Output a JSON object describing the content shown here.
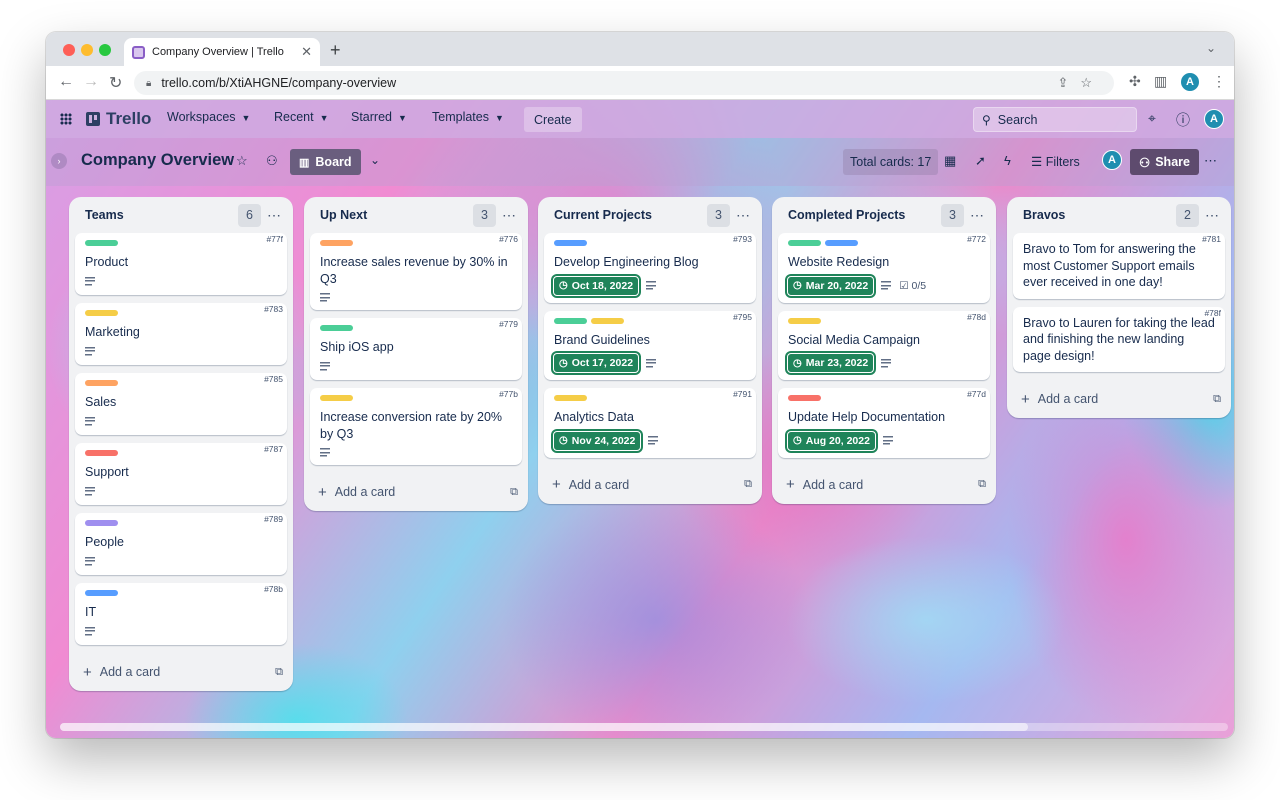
{
  "browser": {
    "tab_title": "Company Overview | Trello",
    "tab_close": "✕",
    "new_tab": "+",
    "url": "trello.com/b/XtiAHGNE/company-overview",
    "profile_initial": "A"
  },
  "topnav": {
    "logo": "Trello",
    "menus": [
      "Workspaces",
      "Recent",
      "Starred",
      "Templates"
    ],
    "create_label": "Create",
    "search_placeholder": "Search",
    "avatar_initial": "A"
  },
  "board": {
    "title": "Company Overview",
    "view_label": "Board",
    "total_cards": "Total cards: 17",
    "filters_label": "Filters",
    "share_label": "Share",
    "member_initial": "A"
  },
  "colors": {
    "green": "#4bce97",
    "yellow": "#f5cd47",
    "orange": "#fea362",
    "red": "#f87168",
    "purple": "#9f8fef",
    "blue": "#579dff",
    "due_green": "#1f845a"
  },
  "lists": [
    {
      "name": "Teams",
      "count": "6",
      "add_label": "Add a card",
      "cards": [
        {
          "id": "#77f",
          "title": "Product",
          "labels": [
            "green"
          ],
          "desc": true
        },
        {
          "id": "#783",
          "title": "Marketing",
          "labels": [
            "yellow"
          ],
          "desc": true
        },
        {
          "id": "#785",
          "title": "Sales",
          "labels": [
            "orange"
          ],
          "desc": true
        },
        {
          "id": "#787",
          "title": "Support",
          "labels": [
            "red"
          ],
          "desc": true
        },
        {
          "id": "#789",
          "title": "People",
          "labels": [
            "purple"
          ],
          "desc": true
        },
        {
          "id": "#78b",
          "title": "IT",
          "labels": [
            "blue"
          ],
          "desc": true
        }
      ]
    },
    {
      "name": "Up Next",
      "count": "3",
      "add_label": "Add a card",
      "cards": [
        {
          "id": "#776",
          "title": "Increase sales revenue by 30% in Q3",
          "labels": [
            "orange"
          ],
          "desc": true
        },
        {
          "id": "#779",
          "title": "Ship iOS app",
          "labels": [
            "green"
          ],
          "desc": true
        },
        {
          "id": "#77b",
          "title": "Increase conversion rate by 20% by Q3",
          "labels": [
            "yellow"
          ],
          "desc": true
        }
      ]
    },
    {
      "name": "Current Projects",
      "count": "3",
      "add_label": "Add a card",
      "cards": [
        {
          "id": "#793",
          "title": "Develop Engineering Blog",
          "labels": [
            "blue"
          ],
          "due": "Oct 18, 2022",
          "desc": true
        },
        {
          "id": "#795",
          "title": "Brand Guidelines",
          "labels": [
            "green",
            "yellow"
          ],
          "due": "Oct 17, 2022",
          "desc": true
        },
        {
          "id": "#791",
          "title": "Analytics Data",
          "labels": [
            "yellow"
          ],
          "due": "Nov 24, 2022",
          "desc": true
        }
      ]
    },
    {
      "name": "Completed Projects",
      "count": "3",
      "add_label": "Add a card",
      "cards": [
        {
          "id": "#772",
          "title": "Website Redesign",
          "labels": [
            "green",
            "blue"
          ],
          "due": "Mar 20, 2022",
          "desc": true,
          "checklist": "0/5"
        },
        {
          "id": "#78d",
          "title": "Social Media Campaign",
          "labels": [
            "yellow"
          ],
          "due": "Mar 23, 2022",
          "desc": true
        },
        {
          "id": "#77d",
          "title": "Update Help Documentation",
          "labels": [
            "red"
          ],
          "due": "Aug 20, 2022",
          "desc": true
        }
      ]
    },
    {
      "name": "Bravos",
      "count": "2",
      "add_label": "Add a card",
      "cards": [
        {
          "id": "#781",
          "title": "Bravo to Tom for answering the most Customer Support emails ever received in one day!",
          "labels": [],
          "desc": false
        },
        {
          "id": "#78f",
          "title": "Bravo to Lauren for taking the lead and finishing the new landing page design!",
          "labels": [],
          "desc": false
        }
      ]
    }
  ]
}
